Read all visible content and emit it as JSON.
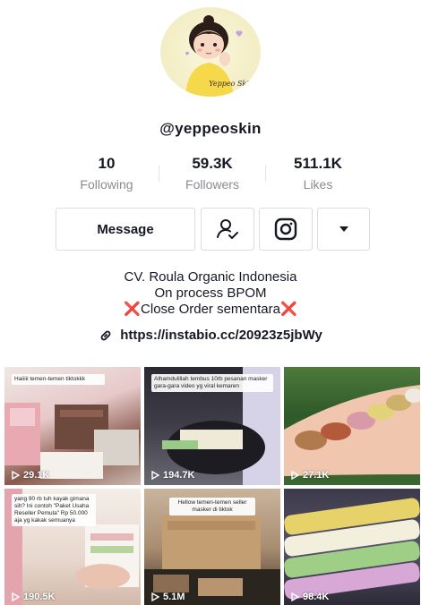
{
  "profile": {
    "handle": "@yeppeoskin",
    "avatar_signature": "Yeppeo Skin"
  },
  "stats": [
    {
      "value": "10",
      "label": "Following"
    },
    {
      "value": "59.3K",
      "label": "Followers"
    },
    {
      "value": "511.1K",
      "label": "Likes"
    }
  ],
  "actions": {
    "message_label": "Message",
    "follow_icon": "person-check-icon",
    "instagram_icon": "instagram-icon",
    "more_icon": "caret-down-icon"
  },
  "bio": {
    "line1": "CV. Roula Organic Indonesia",
    "line2": "On process BPOM",
    "line3_mark": "❌",
    "line3_text": "Close Order sementara",
    "line3_mark_end": "❌"
  },
  "link": {
    "icon": "link-icon",
    "url": "https://instabio.cc/20923z5jbWy"
  },
  "videos": [
    {
      "views": "29.1K",
      "caption": "Haiiiii temen-temen tiktokkk"
    },
    {
      "views": "194.7K",
      "caption": "Alhamdulillah tembus 10rb pesanan masker gara-gara video yg viral kemaren"
    },
    {
      "views": "27.1K",
      "caption": ""
    },
    {
      "views": "190.5K",
      "caption": "yang 90 rb tuh kayak gimana sih? Ini contoh \"Paket Usaha Reseller Pemula\" Rp 50.000 aja yg kakak semuanya"
    },
    {
      "views": "5.1M",
      "caption": "Hellow temen-temen seller masker di tiktok"
    },
    {
      "views": "98.4K",
      "caption": ""
    }
  ],
  "colors": {
    "text": "#161823",
    "muted": "#8a8b91",
    "border": "#dcdcdf",
    "red_mark": "#e0242f"
  }
}
